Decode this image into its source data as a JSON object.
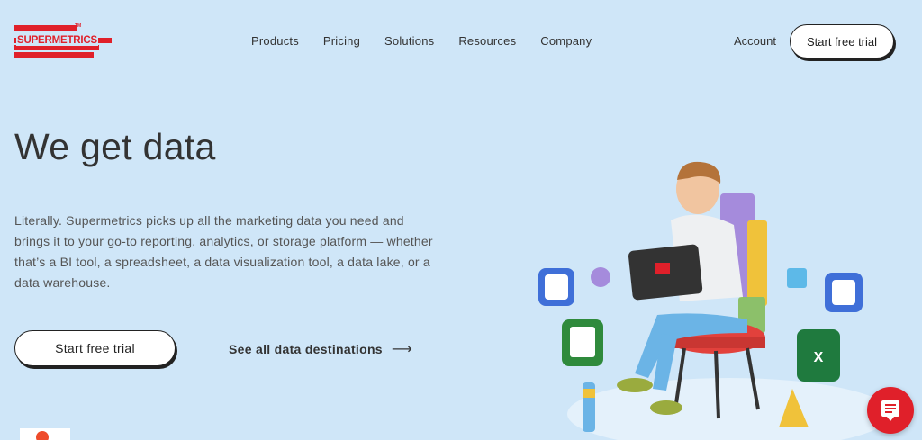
{
  "brand": {
    "logo_text": "SUPERMETRICS",
    "trademark": "TM",
    "accent_color": "#e0202a",
    "background_color": "#cfe6f8"
  },
  "nav": {
    "items": [
      "Products",
      "Pricing",
      "Solutions",
      "Resources",
      "Company"
    ],
    "account_label": "Account",
    "cta_label": "Start free trial"
  },
  "hero": {
    "title": "We get data",
    "description": "Literally. Supermetrics picks up all the marketing data you need and brings it to your go-to reporting, analytics, or storage platform — whether that’s a BI tool, a spreadsheet, a data visualization tool, a data lake, or a data warehouse.",
    "primary_cta": "Start free trial",
    "secondary_link": "See all data destinations",
    "secondary_icon": "arrow-right-icon"
  },
  "widgets": {
    "badge_icon": "g2-badge-icon",
    "chat_icon": "chat-icon"
  }
}
